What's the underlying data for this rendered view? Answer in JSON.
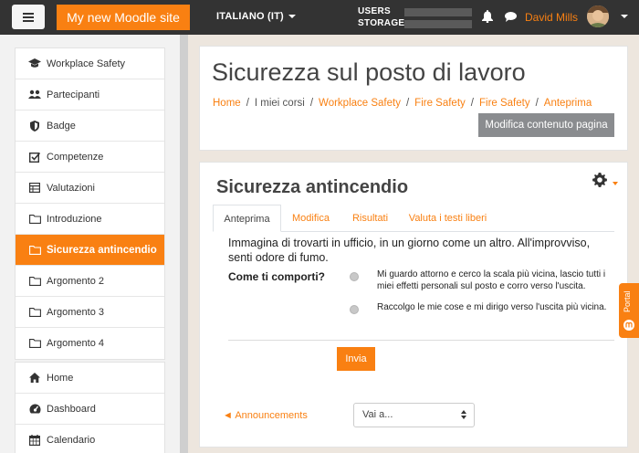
{
  "navbar": {
    "site_name": "My new Moodle site",
    "language": "ITALIANO (IT)",
    "usage": [
      {
        "label": "USERS",
        "fraction": 0.0
      },
      {
        "label": "STORAGE",
        "fraction": 0.0
      }
    ],
    "username": "David Mills"
  },
  "drawer": {
    "course_items": [
      {
        "label": "Workplace Safety",
        "icon": "graduation-cap-icon"
      },
      {
        "label": "Partecipanti",
        "icon": "users-icon"
      },
      {
        "label": "Badge",
        "icon": "shield-icon"
      },
      {
        "label": "Competenze",
        "icon": "checkbox-icon"
      },
      {
        "label": "Valutazioni",
        "icon": "table-icon"
      },
      {
        "label": "Introduzione",
        "icon": "folder-icon"
      },
      {
        "label": "Sicurezza antincendio",
        "icon": "folder-icon",
        "active": true
      },
      {
        "label": "Argomento 2",
        "icon": "folder-icon"
      },
      {
        "label": "Argomento 3",
        "icon": "folder-icon"
      },
      {
        "label": "Argomento 4",
        "icon": "folder-icon"
      }
    ],
    "site_items": [
      {
        "label": "Home",
        "icon": "home-icon"
      },
      {
        "label": "Dashboard",
        "icon": "dashboard-icon"
      },
      {
        "label": "Calendario",
        "icon": "calendar-icon"
      }
    ]
  },
  "header": {
    "title": "Sicurezza sul posto di lavoro",
    "breadcrumb": [
      "Home",
      "I miei corsi",
      "Workplace Safety",
      "Fire Safety",
      "Fire Safety",
      "Anteprima"
    ],
    "edit_button": "Modifica contenuto pagina"
  },
  "activity": {
    "title": "Sicurezza antincendio",
    "tabs": [
      "Anteprima",
      "Modifica",
      "Risultati",
      "Valuta i testi liberi"
    ],
    "active_tab": "Anteprima",
    "question": "Immagina di trovarti in ufficio, in un giorno come un altro. All'improvviso, senti odore di fumo.",
    "prompt": "Come ti comporti?",
    "options": [
      "Mi guardo attorno e cerco la scala più vicina, lascio tutti i miei effetti personali sul posto e corro verso l'uscita.",
      "Raccolgo le mie cose e mi dirigo verso l'uscita più vicina."
    ],
    "submit": "Invia"
  },
  "footer_nav": {
    "previous": "◄ Announcements",
    "jump_to": "Vai a..."
  },
  "portal": {
    "label": "Portal"
  },
  "colors": {
    "accent": "#f98012",
    "navbar": "#333333",
    "button_gray": "#8a8c8f"
  }
}
